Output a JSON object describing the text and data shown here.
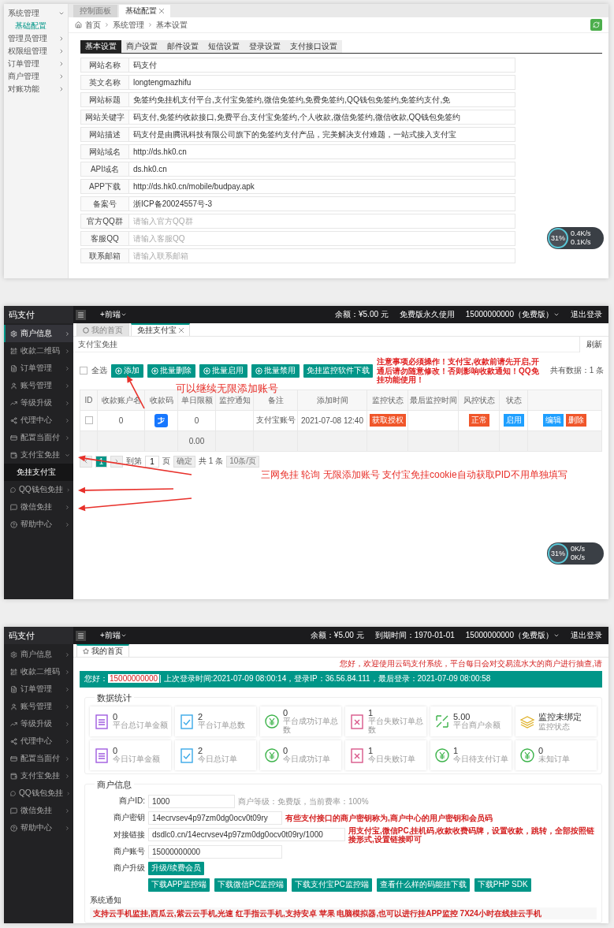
{
  "settings_page": {
    "sidebar": [
      {
        "label": "系统管理",
        "expanded": true,
        "children": [
          {
            "label": "基础配置",
            "selected": true
          }
        ]
      },
      {
        "label": "管理员管理"
      },
      {
        "label": "权限组管理"
      },
      {
        "label": "订单管理"
      },
      {
        "label": "商户管理"
      },
      {
        "label": "对账功能"
      }
    ],
    "tabs": [
      {
        "label": "控制面板",
        "selected": false,
        "closable": false
      },
      {
        "label": "基础配置",
        "selected": true,
        "closable": true
      }
    ],
    "breadcrumb": [
      "首页",
      "系统管理",
      "基本设置"
    ],
    "settings_tabs": [
      {
        "label": "基本设置",
        "selected": true
      },
      {
        "label": "商户设置",
        "selected": false
      },
      {
        "label": "邮件设置",
        "selected": false
      },
      {
        "label": "短信设置",
        "selected": false
      },
      {
        "label": "登录设置",
        "selected": false
      },
      {
        "label": "支付接口设置",
        "selected": false
      }
    ],
    "fields": [
      {
        "label": "网站名称",
        "value": "码支付"
      },
      {
        "label": "英文名称",
        "value": "longtengmazhifu"
      },
      {
        "label": "网站标题",
        "value": "免签约免挂机支付平台,支付宝免签约,微信免签约,免费免签约,QQ钱包免签约,免签约支付,免"
      },
      {
        "label": "网站关键字",
        "value": "码支付,免签约收款接口,免费平台,支付宝免签约,个人收款,微信免签约,微信收款,QQ钱包免签约"
      },
      {
        "label": "网站描述",
        "value": "码支付是由腾讯科技有限公司旗下的免签约支付产品，完美解决支付难题，一站式接入支付宝"
      },
      {
        "label": "网站域名",
        "value": "http://ds.hk0.cn"
      },
      {
        "label": "API域名",
        "value": "ds.hk0.cn"
      },
      {
        "label": "APP下载",
        "value": "http://ds.hk0.cn/mobile/budpay.apk"
      },
      {
        "label": "备案号",
        "value": "浙ICP备20024557号-3"
      },
      {
        "label": "官方QQ群",
        "placeholder": "请输入官方QQ群"
      },
      {
        "label": "客服QQ",
        "placeholder": "请输入客服QQ"
      },
      {
        "label": "联系邮箱",
        "placeholder": "请输入联系邮箱"
      }
    ],
    "monitor": {
      "percent": "31%",
      "upload": "0.4K/s",
      "download": "0.1K/s"
    }
  },
  "alipay_page": {
    "header": {
      "logo": "码支付",
      "menu": "+前端",
      "balance": "余额：¥5.00 元",
      "plan": "免费版永久使用",
      "account": "15000000000（免费版）",
      "logout": "退出登录"
    },
    "sidebar": [
      {
        "label": "商户信息",
        "selected": true
      },
      {
        "label": "收款二维码",
        "selected": false
      },
      {
        "label": "订单管理",
        "selected": false
      },
      {
        "label": "账号管理",
        "selected": false
      },
      {
        "label": "等级升级",
        "selected": false
      },
      {
        "label": "代理中心",
        "selected": false
      },
      {
        "label": "配置当面付",
        "selected": false
      },
      {
        "label": "支付宝免挂",
        "selected": false,
        "expanded": true,
        "children": [
          {
            "label": "免挂支付宝",
            "selected": true
          }
        ]
      },
      {
        "label": "QQ钱包免挂",
        "selected": false
      },
      {
        "label": "微信免挂",
        "selected": false
      },
      {
        "label": "帮助中心",
        "selected": false
      }
    ],
    "tabs": [
      {
        "label": "我的首页",
        "selected": false,
        "closable": false
      },
      {
        "label": "免挂支付宝",
        "selected": true,
        "closable": true
      }
    ],
    "title": "支付宝免挂",
    "refresh": "刷新",
    "select_all": {
      "label": "全选",
      "checked": false
    },
    "actions": [
      {
        "label": "添加",
        "kind": "icon"
      },
      {
        "label": "批量删除",
        "kind": "icon"
      },
      {
        "label": "批量启用",
        "kind": "icon"
      },
      {
        "label": "批量禁用",
        "kind": "icon"
      },
      {
        "label": "免挂监控软件下载",
        "kind": "plain"
      }
    ],
    "notice": "注意事项必须操作！支付宝,收款前请先开启,开通后请勿随意修改！否则影响收款通知！QQ免挂功能使用！",
    "total": "共有数据：1 条",
    "columns": [
      "ID",
      "收款账户名",
      "收款码",
      "单日限额",
      "监控通知",
      "备注",
      "添加时间",
      "监控状态",
      "最后监控时间",
      "风控状态",
      "状态"
    ],
    "rows": [
      {
        "checked": false,
        "account": "0",
        "limit": "0",
        "notify": "",
        "remark": "支付宝账号",
        "time": "2021-07-08 12:40",
        "monitor_status": "获取授权",
        "last_time": "",
        "risk_status": "正常",
        "status": "启用",
        "actions": [
          "编辑",
          "删除"
        ]
      }
    ],
    "sum": "0.00",
    "pagination": {
      "pages": [
        {
          "label": "1",
          "selected": true
        }
      ],
      "goto": "到第",
      "page_input": "1",
      "page_unit": "页",
      "confirm": "确定",
      "total": "共 1 条",
      "page_size": "10条/页"
    },
    "monitor": {
      "percent": "31%",
      "upload": "0K/s",
      "download": "0K/s"
    },
    "annotations": [
      "可以继续无限添加账号",
      "三网免挂 轮询 无限添加账号  支付宝免挂cookie自动获取PID不用单独填写"
    ]
  },
  "dashboard_page": {
    "header": {
      "logo": "码支付",
      "menu": "+前端",
      "balance": "余额：¥5.00 元",
      "plan": "到期时间：1970-01-01",
      "account": "15000000000（免费版）",
      "logout": "退出登录"
    },
    "sidebar": [
      {
        "label": "商户信息",
        "selected": false
      },
      {
        "label": "收款二维码",
        "selected": false
      },
      {
        "label": "订单管理",
        "selected": false
      },
      {
        "label": "账号管理",
        "selected": false
      },
      {
        "label": "等级升级",
        "selected": false
      },
      {
        "label": "代理中心",
        "selected": false
      },
      {
        "label": "配置当面付",
        "selected": false
      },
      {
        "label": "支付宝免挂",
        "selected": false
      },
      {
        "label": "QQ钱包免挂",
        "selected": false
      },
      {
        "label": "微信免挂",
        "selected": false
      },
      {
        "label": "帮助中心",
        "selected": false
      }
    ],
    "tabs": [
      {
        "label": "我的首页",
        "selected": true
      }
    ],
    "marquee": "您好，欢迎使用云码支付系统，平台每日会对交易流水大的商户进行抽查,请",
    "banner": {
      "greeting": "您好：",
      "user": "15000000000",
      "info": "| 上次登录时间:2021-07-09 08:00:14，登录IP：36.56.84.111，最后登录：2021-07-09 08:00:58"
    },
    "stats_title": "数据统计",
    "stats": [
      {
        "kind": "clipboard",
        "value": "0",
        "label": "平台总订单金额"
      },
      {
        "kind": "check",
        "value": "2",
        "label": "平台订单总数"
      },
      {
        "kind": "yen",
        "value": "0",
        "label": "平台成功订单总数"
      },
      {
        "kind": "cross",
        "value": "1",
        "label": "平台失败订单总数"
      },
      {
        "kind": "transfer",
        "value": "5.00",
        "label": "平台商户余额"
      },
      {
        "kind": "coins",
        "value": "监控未绑定",
        "label": "监控状态"
      },
      {
        "kind": "clipboard",
        "value": "0",
        "label": "今日订单金额"
      },
      {
        "kind": "check",
        "value": "2",
        "label": "今日总订单"
      },
      {
        "kind": "yen",
        "value": "0",
        "label": "今日成功订单"
      },
      {
        "kind": "cross",
        "value": "1",
        "label": "今日失败订单"
      },
      {
        "kind": "yen",
        "value": "1",
        "label": "今日待支付订单"
      },
      {
        "kind": "yen",
        "value": "0",
        "label": "未知订单"
      }
    ],
    "merchant_title": "商户信息",
    "merchant_id": {
      "label": "商户ID:",
      "value": "1000",
      "note": "商户等级：免费版，当前费率：100%"
    },
    "merchant_key": {
      "label": "商户密钥",
      "value": "14ecrvsev4p97zm0dg0ocv0t09ry",
      "note": "有些支付接口的商户密钥称为,商户中心的用户密钥和会员码"
    },
    "link": {
      "label": "对接链接",
      "value": "dsdlc0.cn/14ecrvsev4p97zm0dg0ocv0t09ry/1000",
      "note": "用支付宝,微信PC,挂机码,收款收费码牌，设置收款，跳转，全部按照链接形式,设置链接即可"
    },
    "account": {
      "label": "商户账号",
      "value": "15000000000"
    },
    "upgrade": {
      "label": "商户升级",
      "button": "升级/续费会员"
    },
    "downloads": [
      "下载APP监控端",
      "下载微信PC监控端",
      "下载支付宝PC监控端",
      "查看什么样的码能挂下载",
      "下载PHP SDK"
    ],
    "notice_title": "系统通知",
    "notice": "支持云手机监挂,西瓜云,紫云云手机,光速 红手指云手机,支持安卓 苹果 电脑模拟器,也可以进行挂APP监控 7X24小时在线挂云手机"
  }
}
